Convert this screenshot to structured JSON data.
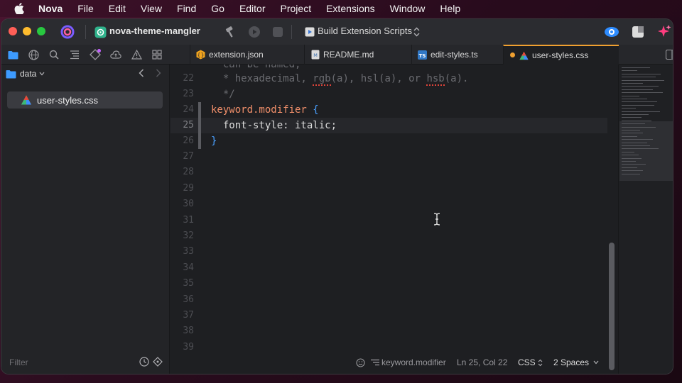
{
  "menubar": {
    "app": "Nova",
    "items": [
      "File",
      "Edit",
      "View",
      "Find",
      "Go",
      "Editor",
      "Project",
      "Extensions",
      "Window",
      "Help"
    ]
  },
  "titlebar": {
    "project": "nova-theme-mangler",
    "task": "Build Extension Scripts"
  },
  "tabs": [
    {
      "label": "extension.json",
      "icon": "json-file-icon",
      "active": false
    },
    {
      "label": "README.md",
      "icon": "markdown-file-icon",
      "active": false
    },
    {
      "label": "edit-styles.ts",
      "icon": "typescript-file-icon",
      "active": false
    },
    {
      "label": "user-styles.css",
      "icon": "css-file-icon",
      "active": true,
      "modified": true
    }
  ],
  "sidebar": {
    "folder": "data",
    "files": [
      {
        "label": "user-styles.css",
        "icon": "css-file-icon",
        "selected": true
      }
    ],
    "filter_placeholder": "Filter"
  },
  "editor": {
    "lines": [
      {
        "n": "",
        "text": "  can be named,"
      },
      {
        "n": "22",
        "text": "  * hexadecimal, rgb(a), hsl(a), or hsb(a)."
      },
      {
        "n": "23",
        "text": "  */"
      },
      {
        "n": "24",
        "text": "keyword.modifier {"
      },
      {
        "n": "25",
        "text": "  font-style: italic;"
      },
      {
        "n": "26",
        "text": "}"
      },
      {
        "n": "27",
        "text": ""
      },
      {
        "n": "28",
        "text": ""
      },
      {
        "n": "29",
        "text": ""
      },
      {
        "n": "30",
        "text": ""
      },
      {
        "n": "31",
        "text": ""
      },
      {
        "n": "32",
        "text": ""
      },
      {
        "n": "33",
        "text": ""
      },
      {
        "n": "34",
        "text": ""
      },
      {
        "n": "35",
        "text": ""
      },
      {
        "n": "36",
        "text": ""
      },
      {
        "n": "37",
        "text": ""
      },
      {
        "n": "38",
        "text": ""
      },
      {
        "n": "39",
        "text": ""
      }
    ],
    "current_line": "25"
  },
  "status": {
    "symbol": "keyword.modifier",
    "position": "Ln 25, Col 22",
    "syntax": "CSS",
    "indent": "2 Spaces"
  },
  "colors": {
    "accent_tab": "#f0a030",
    "selector": "#f08f6a",
    "brace": "#4aa0ff",
    "comment": "#6a6b70"
  }
}
